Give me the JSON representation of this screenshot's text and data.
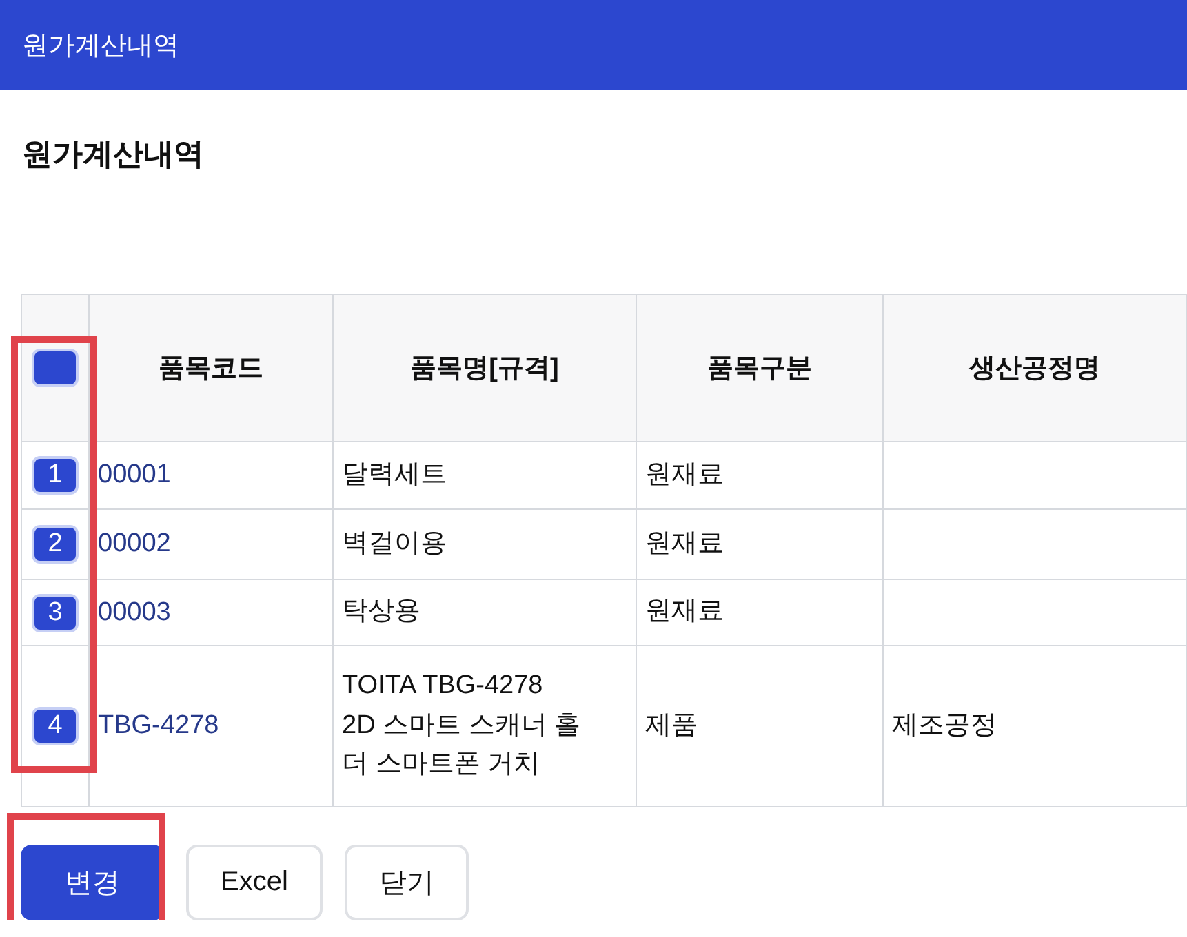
{
  "window": {
    "title": "원가계산내역"
  },
  "heading": "원가계산내역",
  "table": {
    "header_checked": true,
    "columns": [
      "품목코드",
      "품목명[규격]",
      "품목구분",
      "생산공정명"
    ],
    "rows": [
      {
        "number": "1",
        "checked": true,
        "code": "00001",
        "name": [
          "달력세트"
        ],
        "type": "원재료",
        "process": ""
      },
      {
        "number": "2",
        "checked": true,
        "code": "00002",
        "name": [
          "벽걸이용"
        ],
        "type": "원재료",
        "process": ""
      },
      {
        "number": "3",
        "checked": true,
        "code": "00003",
        "name": [
          "탁상용"
        ],
        "type": "원재료",
        "process": ""
      },
      {
        "number": "4",
        "checked": true,
        "code": "TBG-4278",
        "name": [
          "TOITA TBG-4278",
          "2D 스마트 스캐너 홀",
          "더 스마트폰 거치"
        ],
        "type": "제품",
        "process": "제조공정"
      }
    ]
  },
  "highlights": {
    "checkbox_column": true,
    "change_button": true
  },
  "buttons": [
    {
      "label": "변경",
      "kind": "primary"
    },
    {
      "label": "Excel",
      "kind": "plain"
    },
    {
      "label": "닫기",
      "kind": "plain"
    }
  ]
}
